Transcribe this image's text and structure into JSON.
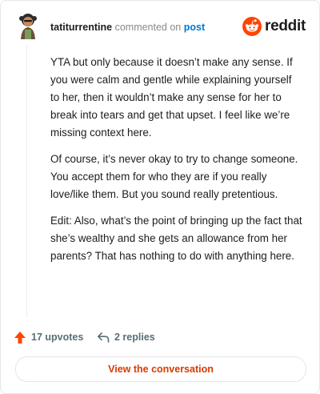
{
  "header": {
    "username": "tatiturrentine",
    "action_text": "commented on",
    "post_link": "post",
    "brand_name": "reddit"
  },
  "comment": {
    "paragraphs": [
      "YTA but only because it doesn’t make any sense. If you were calm and gentle while explaining yourself to her, then it wouldn’t make any sense for her to break into tears and get that upset. I feel like we’re missing context here.",
      "Of course, it’s never okay to try to change someone. You accept them for who they are if you really love/like them. But you sound really pretentious.",
      "Edit: Also, what’s the point of bringing up the fact that she’s wealthy and she gets an allowance from her parents? That has nothing to do with anything here."
    ]
  },
  "actions": {
    "upvotes_label": "17 upvotes",
    "replies_label": "2 replies",
    "upvote_icon": "upvote-arrow-icon",
    "reply_icon": "reply-arrow-icon"
  },
  "cta": {
    "label": "View the conversation"
  },
  "colors": {
    "brand_orange": "#ff4500",
    "link_blue": "#0079d3",
    "cta_text": "#d93a00",
    "action_gray": "#576f76",
    "meta_gray": "#878a8c"
  }
}
